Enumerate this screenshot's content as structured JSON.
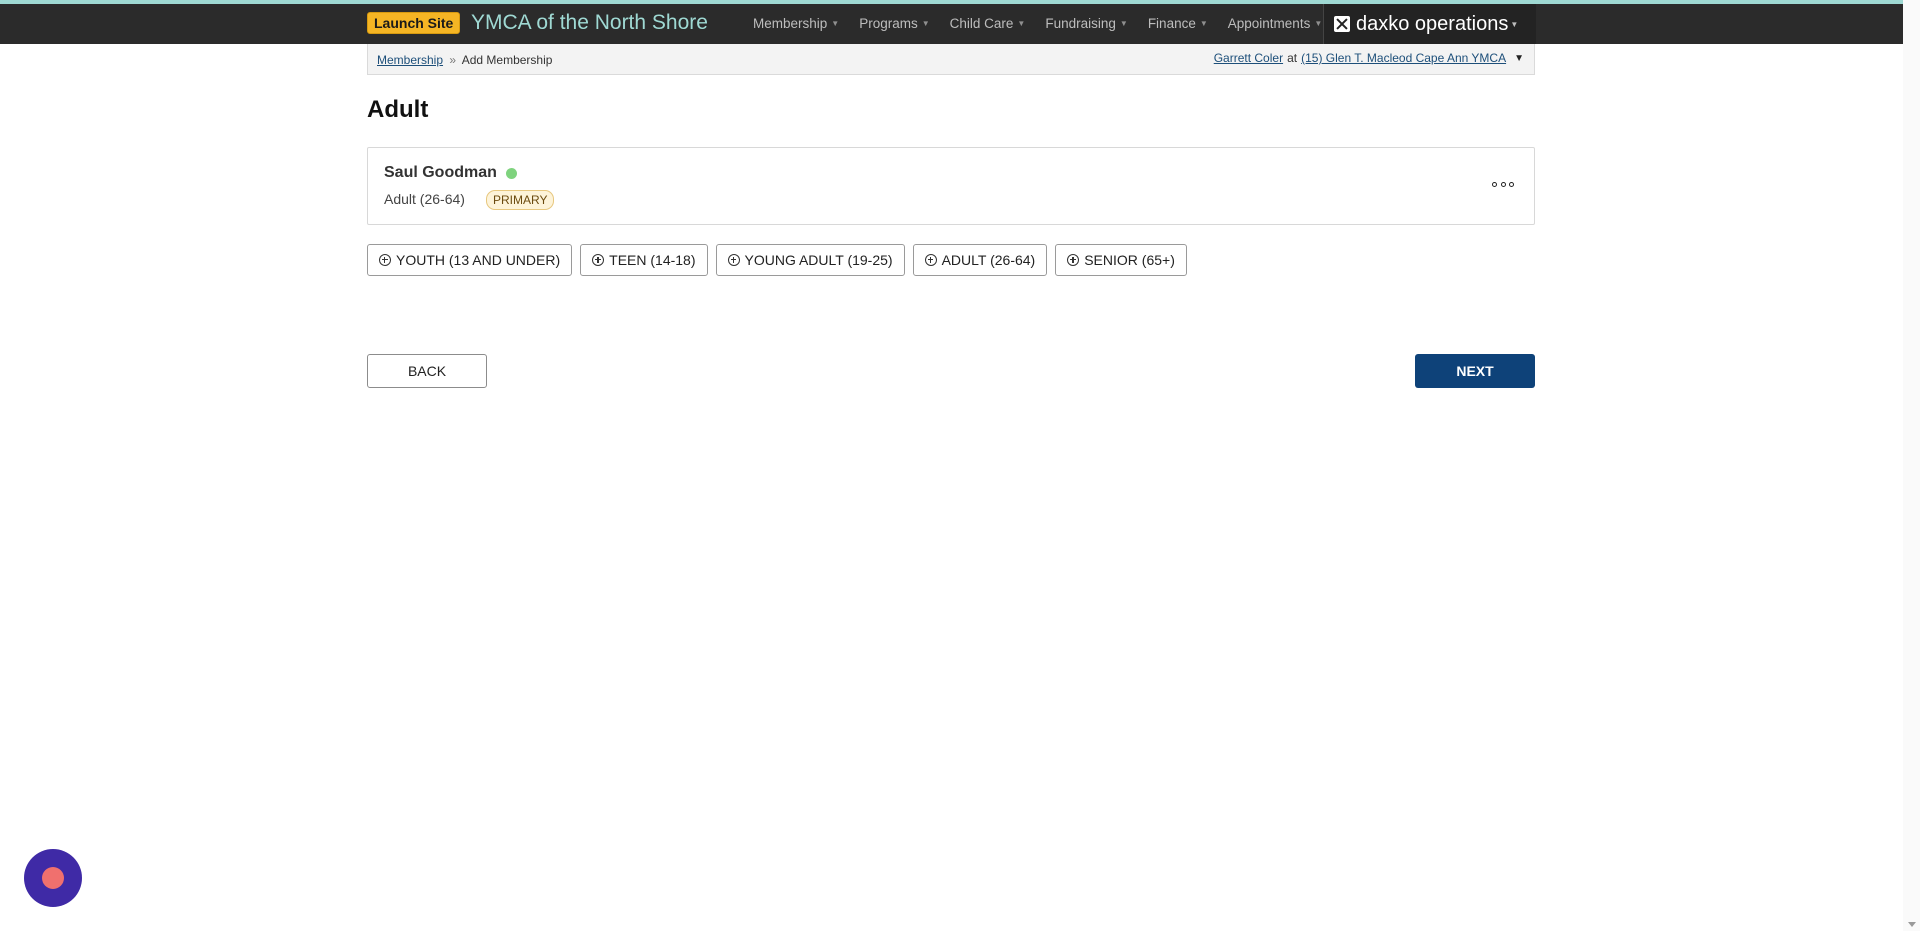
{
  "nav": {
    "launch_label": "Launch Site",
    "org_title": "YMCA of the North Shore",
    "menu": [
      {
        "label": "Membership"
      },
      {
        "label": "Programs"
      },
      {
        "label": "Child Care"
      },
      {
        "label": "Fundraising"
      },
      {
        "label": "Finance"
      },
      {
        "label": "Appointments"
      }
    ],
    "brand": "daxko operations",
    "brand_icon": "envelope-x-icon",
    "colors": {
      "bar": "#2b2b2b",
      "title": "#9fd9d3",
      "launch": "#f5b524"
    }
  },
  "breadcrumb": {
    "root": "Membership",
    "separator": "»",
    "current": "Add Membership"
  },
  "user": {
    "name": "Garrett Coler",
    "at": "at",
    "location": "(15) Glen T. Macleod Cape Ann YMCA"
  },
  "page": {
    "title": "Adult"
  },
  "member": {
    "name": "Saul Goodman",
    "status": "active",
    "status_color": "#7fd37e",
    "age_group": "Adult (26-64)",
    "badge": "PRIMARY"
  },
  "age_buttons": [
    {
      "label": "YOUTH (13 AND UNDER)"
    },
    {
      "label": "TEEN (14-18)"
    },
    {
      "label": "YOUNG ADULT (19-25)"
    },
    {
      "label": "ADULT (26-64)"
    },
    {
      "label": "SENIOR (65+)"
    }
  ],
  "actions": {
    "back": "BACK",
    "next": "NEXT",
    "next_color": "#0e4279"
  }
}
